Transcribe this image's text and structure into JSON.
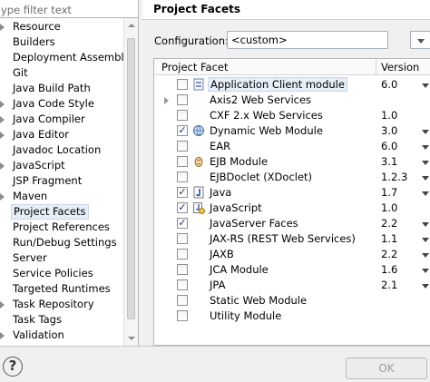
{
  "filter": {
    "placeholder": "ype filter text"
  },
  "tree": [
    {
      "label": "Resource",
      "expandable": true
    },
    {
      "label": "Builders",
      "expandable": false
    },
    {
      "label": "Deployment Assembly",
      "expandable": false
    },
    {
      "label": "Git",
      "expandable": false
    },
    {
      "label": "Java Build Path",
      "expandable": false
    },
    {
      "label": "Java Code Style",
      "expandable": true
    },
    {
      "label": "Java Compiler",
      "expandable": true
    },
    {
      "label": "Java Editor",
      "expandable": true
    },
    {
      "label": "Javadoc Location",
      "expandable": false
    },
    {
      "label": "JavaScript",
      "expandable": true
    },
    {
      "label": "JSP Fragment",
      "expandable": false
    },
    {
      "label": "Maven",
      "expandable": true
    },
    {
      "label": "Project Facets",
      "expandable": false,
      "selected": true
    },
    {
      "label": "Project References",
      "expandable": false
    },
    {
      "label": "Run/Debug Settings",
      "expandable": false
    },
    {
      "label": "Server",
      "expandable": false
    },
    {
      "label": "Service Policies",
      "expandable": false
    },
    {
      "label": "Targeted Runtimes",
      "expandable": false
    },
    {
      "label": "Task Repository",
      "expandable": true
    },
    {
      "label": "Task Tags",
      "expandable": false
    },
    {
      "label": "Validation",
      "expandable": true
    }
  ],
  "right": {
    "title": "Project Facets",
    "configuration_label": "Configuration:",
    "configuration_value": "<custom>",
    "table": {
      "col_facet": "Project Facet",
      "col_version": "Version",
      "rows": [
        {
          "name": "Application Client module",
          "version": "6.0",
          "checked": false,
          "icon": "module",
          "expandable": false,
          "dropdown": true,
          "highlight": true
        },
        {
          "name": "Axis2 Web Services",
          "version": "",
          "checked": false,
          "icon": "none",
          "expandable": true,
          "dropdown": false
        },
        {
          "name": "CXF 2.x Web Services",
          "version": "1.0",
          "checked": false,
          "icon": "none",
          "expandable": false,
          "dropdown": false
        },
        {
          "name": "Dynamic Web Module",
          "version": "3.0",
          "checked": true,
          "icon": "web",
          "expandable": false,
          "dropdown": true
        },
        {
          "name": "EAR",
          "version": "6.0",
          "checked": false,
          "icon": "none",
          "expandable": false,
          "dropdown": true
        },
        {
          "name": "EJB Module",
          "version": "3.1",
          "checked": false,
          "icon": "ejb",
          "expandable": false,
          "dropdown": true
        },
        {
          "name": "EJBDoclet (XDoclet)",
          "version": "1.2.3",
          "checked": false,
          "icon": "none",
          "expandable": false,
          "dropdown": true
        },
        {
          "name": "Java",
          "version": "1.7",
          "checked": true,
          "icon": "java",
          "expandable": false,
          "dropdown": true
        },
        {
          "name": "JavaScript",
          "version": "1.0",
          "checked": true,
          "icon": "js",
          "expandable": false,
          "dropdown": false
        },
        {
          "name": "JavaServer Faces",
          "version": "2.2",
          "checked": true,
          "icon": "none",
          "expandable": false,
          "dropdown": true
        },
        {
          "name": "JAX-RS (REST Web Services)",
          "version": "1.1",
          "checked": false,
          "icon": "none",
          "expandable": false,
          "dropdown": true
        },
        {
          "name": "JAXB",
          "version": "2.2",
          "checked": false,
          "icon": "none",
          "expandable": false,
          "dropdown": true
        },
        {
          "name": "JCA Module",
          "version": "1.6",
          "checked": false,
          "icon": "none",
          "expandable": false,
          "dropdown": true
        },
        {
          "name": "JPA",
          "version": "2.1",
          "checked": false,
          "icon": "none",
          "expandable": false,
          "dropdown": true
        },
        {
          "name": "Static Web Module",
          "version": "",
          "checked": false,
          "icon": "none",
          "expandable": false,
          "dropdown": false
        },
        {
          "name": "Utility Module",
          "version": "",
          "checked": false,
          "icon": "none",
          "expandable": false,
          "dropdown": false
        }
      ]
    }
  },
  "bottom": {
    "help_icon": "?",
    "ok_label": "OK"
  }
}
